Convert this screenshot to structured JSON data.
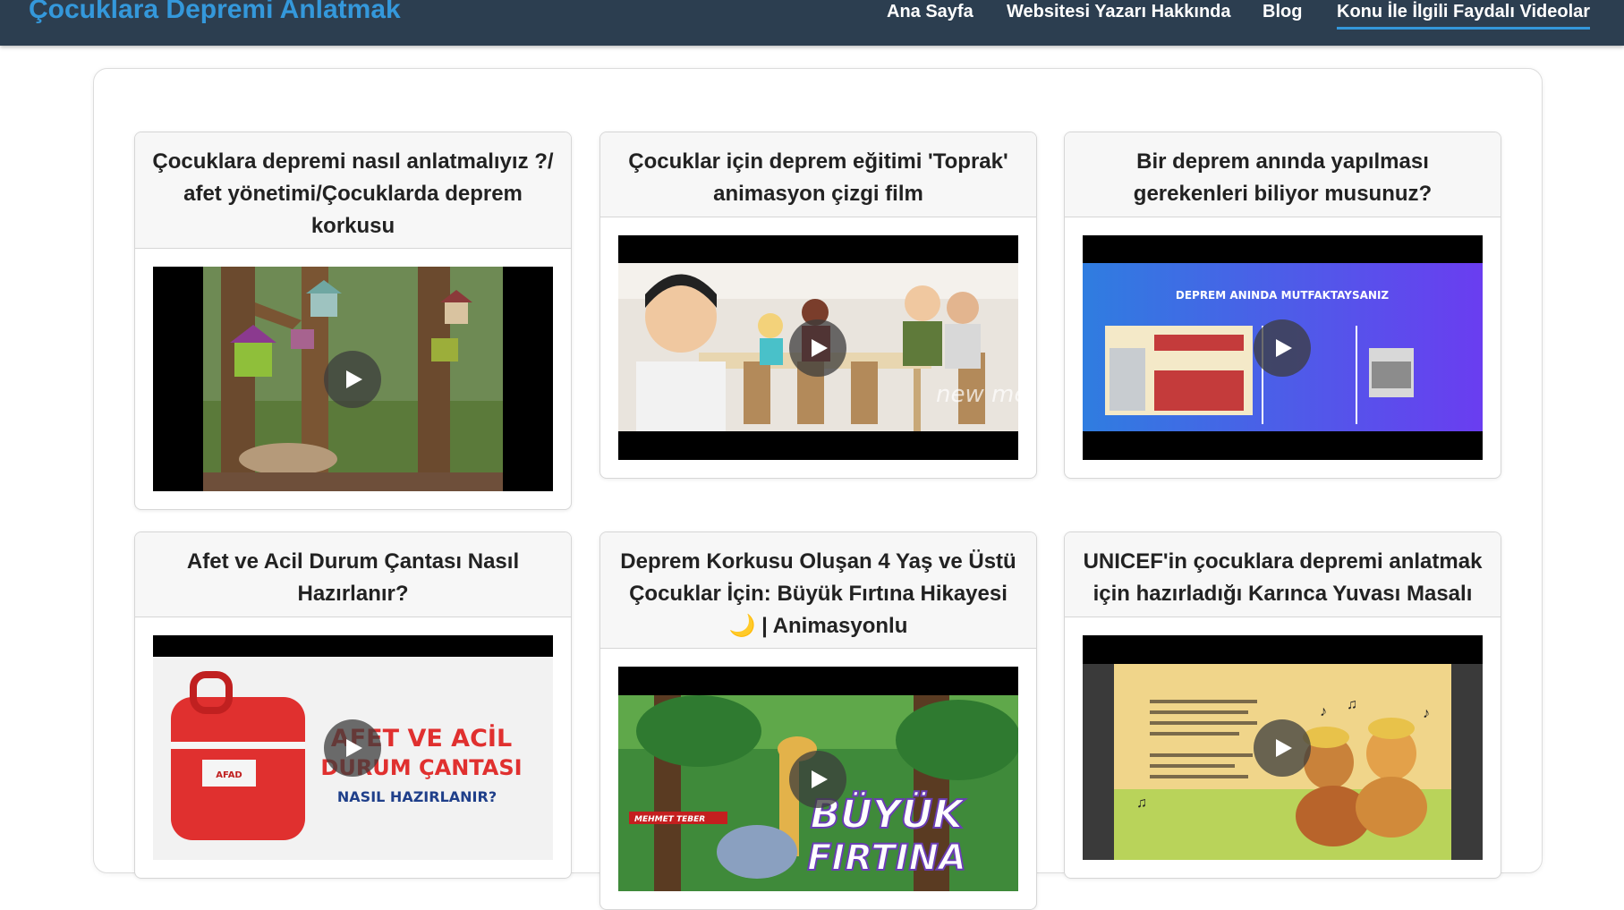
{
  "site": {
    "brand": "Çocuklara Depremi Anlatmak"
  },
  "nav": {
    "items": [
      {
        "label": "Ana Sayfa"
      },
      {
        "label": "Websitesi Yazarı Hakkında"
      },
      {
        "label": "Blog"
      },
      {
        "label": "Konu İle İlgili Faydalı Videolar",
        "active": true
      }
    ]
  },
  "videos": [
    {
      "title": "Çocuklara depremi nasıl anlatmalıyız ?/ afet yönetimi/Çocuklarda deprem korkusu"
    },
    {
      "title": "Çocuklar için deprem eğitimi 'Toprak' animasyon çizgi film",
      "thumb_text": "new medya"
    },
    {
      "title": "Bir deprem anında yapılması gerekenleri biliyor musunuz?",
      "thumb_text": "DEPREM ANINDA MUTFAKTAYSANIZ"
    },
    {
      "title": "Afet ve Acil Durum Çantası Nasıl Hazırlanır?",
      "thumb_text_1": "AFET VE ACİL",
      "thumb_text_2": "DURUM ÇANTASI",
      "thumb_text_3": "NASIL HAZIRLANIR?",
      "bag_label": "AFAD"
    },
    {
      "title": "Deprem Korkusu Oluşan 4 Yaş ve Üstü Çocuklar İçin: Büyük Fırtına Hikayesi 🌙 | Animasyonlu",
      "thumb_text_1": "BÜYÜK",
      "thumb_text_2": "FIRTINA",
      "author_tag": "MEHMET TEBER"
    },
    {
      "title": "UNICEF'in çocuklara depremi anlatmak için hazırladığı Karınca Yuvası Masalı"
    }
  ],
  "colors": {
    "navbar": "#2c3e50",
    "brand": "#3498db",
    "accent": "#3498db"
  }
}
